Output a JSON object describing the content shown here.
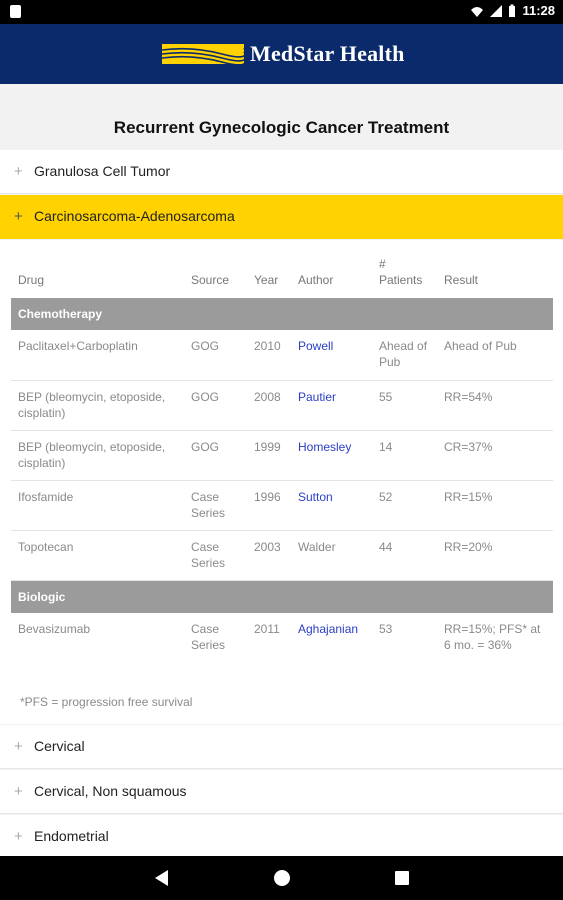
{
  "status_bar": {
    "time": "11:28",
    "icons": [
      "notification-icon",
      "wifi-icon",
      "signal-icon",
      "battery-icon"
    ]
  },
  "header": {
    "brand": "MedStar Health",
    "brand_color": "#0a2a6b",
    "accent_color": "#ffd200"
  },
  "page": {
    "title": "Recurrent Gynecologic Cancer Treatment"
  },
  "accordion": [
    {
      "label": "Granulosa Cell Tumor",
      "expanded": false
    },
    {
      "label": "Carcinosarcoma-Adenosarcoma",
      "expanded": true
    },
    {
      "label": "Cervical",
      "expanded": false
    },
    {
      "label": "Cervical, Non squamous",
      "expanded": false
    },
    {
      "label": "Endometrial",
      "expanded": false
    }
  ],
  "table": {
    "headers": {
      "drug": "Drug",
      "source": "Source",
      "year": "Year",
      "author": "Author",
      "patients": "# Patients",
      "result": "Result"
    },
    "sections": [
      {
        "name": "Chemotherapy",
        "rows": [
          {
            "drug": "Paclitaxel+Carboplatin",
            "source": "GOG",
            "year": "2010",
            "author": "Powell",
            "author_link": true,
            "patients": "Ahead of Pub",
            "result": "Ahead of Pub"
          },
          {
            "drug": "BEP (bleomycin, etoposide, cisplatin)",
            "source": "GOG",
            "year": "2008",
            "author": "Pautier",
            "author_link": true,
            "patients": "55",
            "result": "RR=54%"
          },
          {
            "drug": "BEP (bleomycin, etoposide, cisplatin)",
            "source": "GOG",
            "year": "1999",
            "author": "Homesley",
            "author_link": true,
            "patients": "14",
            "result": "CR=37%"
          },
          {
            "drug": "Ifosfamide",
            "source": "Case Series",
            "year": "1996",
            "author": "Sutton",
            "author_link": true,
            "patients": "52",
            "result": "RR=15%"
          },
          {
            "drug": "Topotecan",
            "source": "Case Series",
            "year": "2003",
            "author": "Walder",
            "author_link": false,
            "patients": "44",
            "result": "RR=20%"
          }
        ]
      },
      {
        "name": "Biologic",
        "rows": [
          {
            "drug": "Bevasizumab",
            "source": "Case Series",
            "year": "2011",
            "author": "Aghajanian",
            "author_link": true,
            "patients": "53",
            "result": "RR=15%; PFS* at 6 mo. = 36%"
          }
        ]
      }
    ],
    "footnote": "*PFS = progression free survival"
  },
  "nav": {
    "icons": [
      "back-icon",
      "home-icon",
      "recents-icon"
    ]
  }
}
